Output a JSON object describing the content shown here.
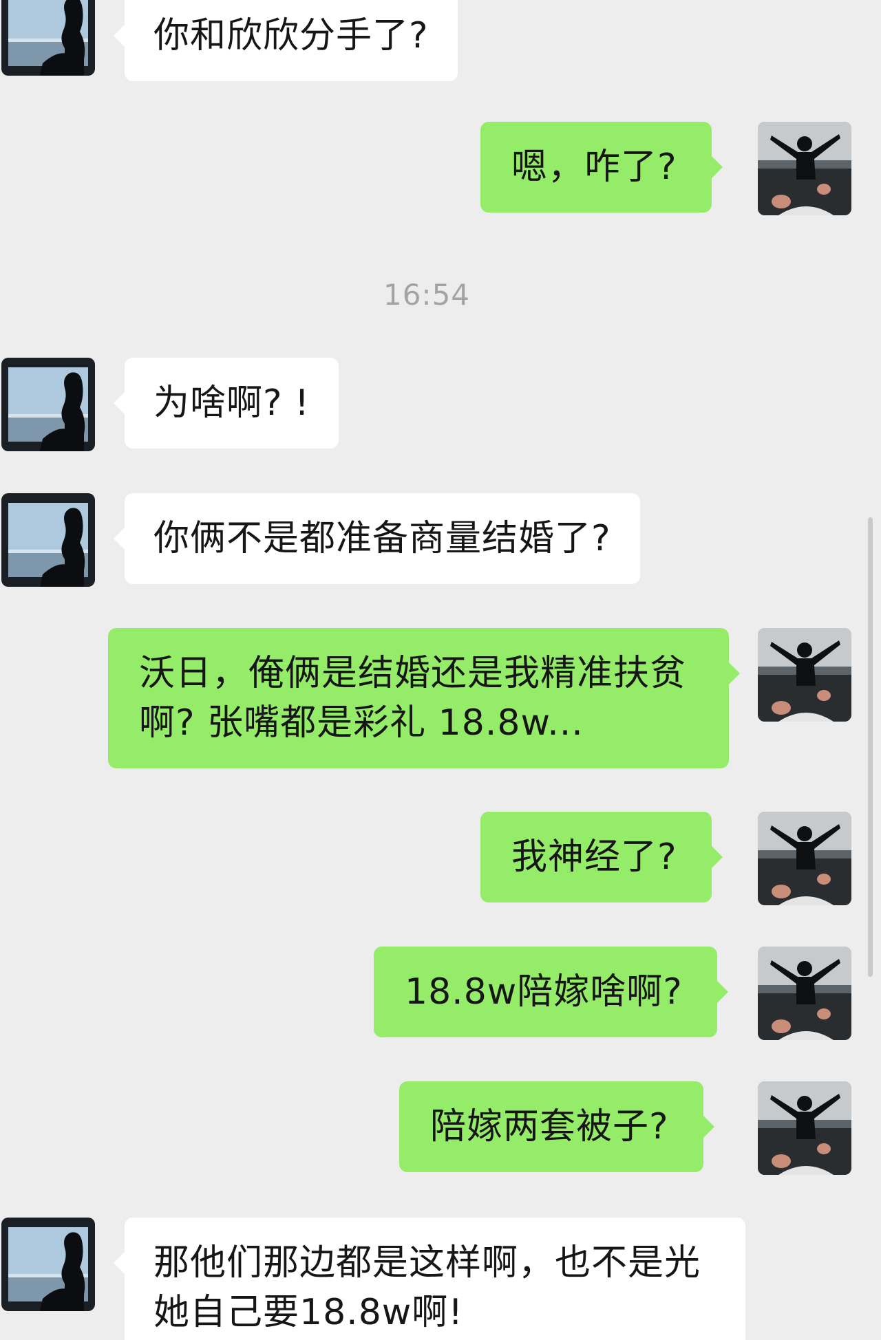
{
  "colors": {
    "background": "#ededed",
    "incoming_bubble": "#ffffff",
    "outgoing_bubble": "#95ec69",
    "text": "#161616",
    "timestamp": "#a3a3a3"
  },
  "timestamp": "16:54",
  "messages": [
    {
      "side": "in",
      "text": "你和欣欣分手了?"
    },
    {
      "side": "out",
      "text": "嗯，咋了?"
    },
    {
      "side": "in",
      "text": "为啥啊? !"
    },
    {
      "side": "in",
      "text": "你俩不是都准备商量结婚了?"
    },
    {
      "side": "out",
      "text": "沃日，俺俩是结婚还是我精准扶贫啊? 张嘴都是彩礼 18.8w..."
    },
    {
      "side": "out",
      "text": "我神经了?"
    },
    {
      "side": "out",
      "text": "18.8w陪嫁啥啊?"
    },
    {
      "side": "out",
      "text": "陪嫁两套被子?"
    },
    {
      "side": "in",
      "text": "那他们那边都是这样啊，也不是光她自己要18.8w啊!"
    }
  ]
}
